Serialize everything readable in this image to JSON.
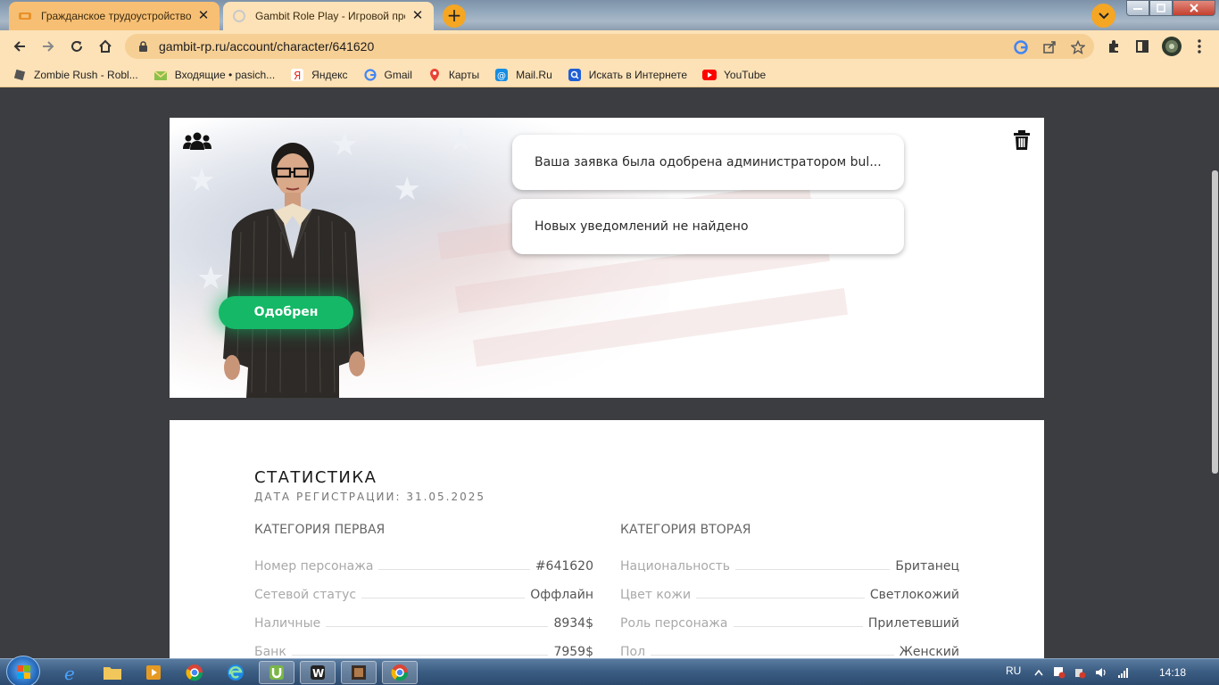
{
  "browser": {
    "tabs": [
      {
        "title": "Гражданское трудоустройство |",
        "active": false
      },
      {
        "title": "Gambit Role Play - Игровой про",
        "active": true
      }
    ],
    "url": "gambit-rp.ru/account/character/641620",
    "accent_color": "#f5a623",
    "bookmarks": [
      {
        "label": "Zombie Rush - Robl...",
        "icon": "roblox-icon"
      },
      {
        "label": "Входящие • pasich...",
        "icon": "mail-envelope-icon"
      },
      {
        "label": "Яндекс",
        "icon": "yandex-icon"
      },
      {
        "label": "Gmail",
        "icon": "google-icon"
      },
      {
        "label": "Карты",
        "icon": "maps-icon"
      },
      {
        "label": "Mail.Ru",
        "icon": "mailru-icon"
      },
      {
        "label": "Искать в Интернете",
        "icon": "search-icon"
      },
      {
        "label": "YouTube",
        "icon": "youtube-icon"
      }
    ]
  },
  "character": {
    "status_badge": "Одобрен",
    "status_color": "#14b866",
    "notifications": [
      "Ваша заявка была одобрена администратором bul...",
      "Новых уведомлений не найдено"
    ]
  },
  "stats": {
    "title": "СТАТИСТИКА",
    "registration": "ДАТА РЕГИСТРАЦИИ: 31.05.2025",
    "category_one": {
      "title": "КАТЕГОРИЯ ПЕРВАЯ",
      "rows": [
        {
          "label": "Номер персонажа",
          "value": "#641620"
        },
        {
          "label": "Сетевой статус",
          "value": "Оффлайн"
        },
        {
          "label": "Наличные",
          "value": "8934$"
        },
        {
          "label": "Банк",
          "value": "7959$"
        }
      ]
    },
    "category_two": {
      "title": "КАТЕГОРИЯ ВТОРАЯ",
      "rows": [
        {
          "label": "Национальность",
          "value": "Британец"
        },
        {
          "label": "Цвет кожи",
          "value": "Светлокожий"
        },
        {
          "label": "Роль персонажа",
          "value": "Прилетевший"
        },
        {
          "label": "Пол",
          "value": "Женский"
        }
      ]
    }
  },
  "taskbar": {
    "language": "RU",
    "clock": "14:18"
  }
}
